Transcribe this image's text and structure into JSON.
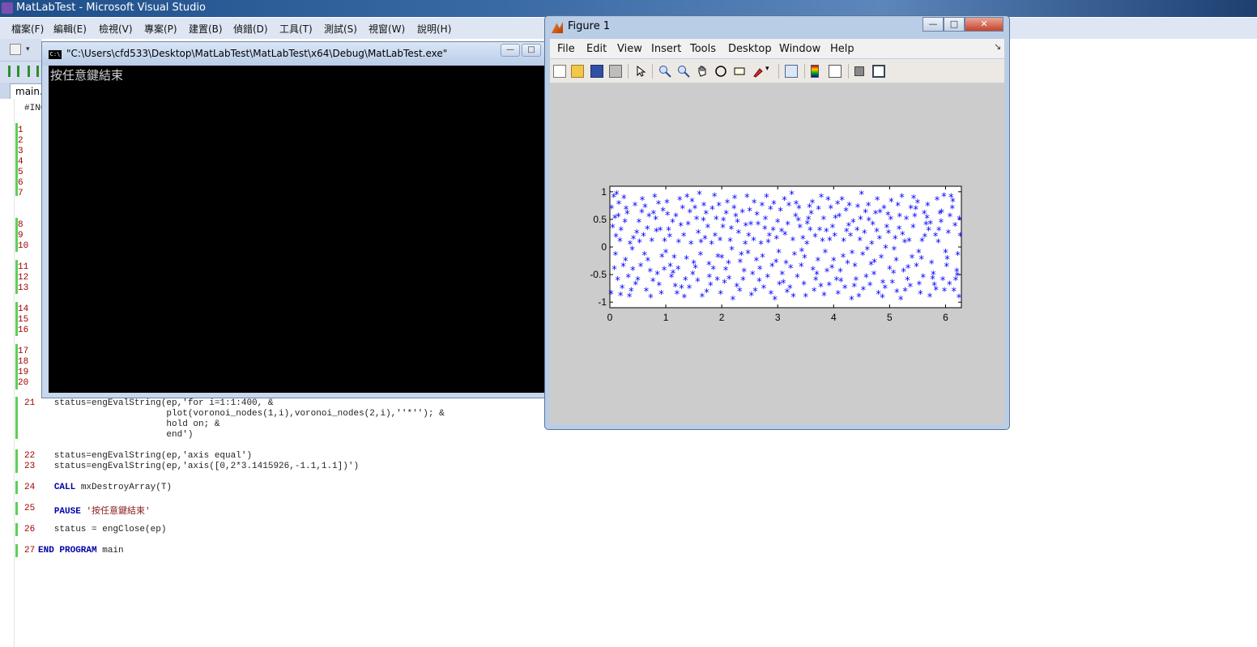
{
  "vs": {
    "window_title": "MatLabTest - Microsoft Visual Studio",
    "menu": [
      "檔案(F)",
      "編輯(E)",
      "檢視(V)",
      "專案(P)",
      "建置(B)",
      "偵錯(D)",
      "工具(T)",
      "測試(S)",
      "視窗(W)",
      "說明(H)"
    ],
    "tab_label": "main.",
    "first_line_fragment": "#INC"
  },
  "code": {
    "visible_line_numbers": [
      "1",
      "2",
      "3",
      "4",
      "5",
      "6",
      "7",
      "8",
      "9",
      "10",
      "11",
      "12",
      "13",
      "14",
      "15",
      "16",
      "17",
      "18",
      "19",
      "20"
    ],
    "lines": [
      {
        "num": "21",
        "text": "   status=engEvalString(ep,'for i=1:1:400, &"
      },
      {
        "num": "",
        "text": "                        plot(voronoi_nodes(1,i),voronoi_nodes(2,i),''*''); &"
      },
      {
        "num": "",
        "text": "                        hold on; &"
      },
      {
        "num": "",
        "text": "                        end')"
      },
      {
        "num": "22",
        "text": "   status=engEvalString(ep,'axis equal')"
      },
      {
        "num": "23",
        "text": "   status=engEvalString(ep,'axis([0,2*3.1415926,-1.1,1.1])')"
      },
      {
        "num": "24",
        "kw": "CALL",
        "text": " mxDestroyArray(T)"
      },
      {
        "num": "25",
        "kw": "PAUSE",
        "str": "'按任意鍵結束'"
      },
      {
        "num": "26",
        "text": "   status = engClose(ep)"
      },
      {
        "num": "27",
        "kw": "END PROGRAM",
        "text": " main"
      }
    ]
  },
  "console": {
    "title": "\"C:\\Users\\cfd533\\Desktop\\MatLabTest\\MatLabTest\\x64\\Debug\\MatLabTest.exe\"",
    "icon_label": "C:\\",
    "output": "按任意鍵結束",
    "min_btn": "—",
    "max_btn": "□"
  },
  "figure": {
    "title": "Figure 1",
    "menu": [
      "File",
      "Edit",
      "View",
      "Insert",
      "Tools",
      "Desktop",
      "Window",
      "Help"
    ],
    "menu_arrow": "↘",
    "min_btn": "—",
    "max_btn": "□",
    "close_btn": "✕"
  },
  "chart_data": {
    "type": "scatter",
    "marker": "*",
    "color": "#0000ff",
    "xlim": [
      0,
      6.2832
    ],
    "ylim": [
      -1.1,
      1.1
    ],
    "xticks": [
      "0",
      "1",
      "2",
      "3",
      "4",
      "5",
      "6"
    ],
    "yticks": [
      "1",
      "0.5",
      "0",
      "-0.5",
      "-1"
    ],
    "xtick_values": [
      0,
      1,
      2,
      3,
      4,
      5,
      6
    ],
    "ytick_values": [
      1,
      0.5,
      0,
      -0.5,
      -1
    ],
    "n_points": 400,
    "points": [
      [
        0.12,
        0.95
      ],
      [
        0.25,
        0.88
      ],
      [
        0.31,
        0.6
      ],
      [
        0.05,
        0.35
      ],
      [
        0.18,
        0.1
      ],
      [
        0.4,
        -0.05
      ],
      [
        0.08,
        -0.4
      ],
      [
        0.22,
        -0.75
      ],
      [
        0.35,
        -0.9
      ],
      [
        0.5,
        -0.6
      ],
      [
        0.6,
        0.2
      ],
      [
        0.7,
        0.55
      ],
      [
        0.8,
        0.9
      ],
      [
        0.9,
        0.3
      ],
      [
        1.0,
        -0.1
      ],
      [
        1.1,
        -0.55
      ],
      [
        1.2,
        -0.85
      ],
      [
        1.3,
        0.7
      ],
      [
        1.4,
        0.4
      ],
      [
        1.5,
        -0.3
      ],
      [
        1.6,
        0.95
      ],
      [
        1.7,
        0.15
      ],
      [
        1.8,
        -0.7
      ],
      [
        1.9,
        0.5
      ],
      [
        2.0,
        -0.2
      ],
      [
        2.1,
        0.8
      ],
      [
        2.2,
        -0.95
      ],
      [
        2.3,
        0.25
      ],
      [
        2.4,
        -0.45
      ],
      [
        2.5,
        0.65
      ],
      [
        2.6,
        -0.8
      ],
      [
        2.7,
        0.05
      ],
      [
        2.8,
        0.9
      ],
      [
        2.9,
        -0.35
      ],
      [
        3.0,
        0.45
      ],
      [
        3.1,
        -0.65
      ],
      [
        3.2,
        0.75
      ],
      [
        3.3,
        -0.15
      ],
      [
        3.4,
        0.35
      ],
      [
        3.5,
        -0.9
      ],
      [
        3.6,
        0.6
      ],
      [
        3.7,
        -0.5
      ],
      [
        3.8,
        0.1
      ],
      [
        3.9,
        0.85
      ],
      [
        4.0,
        -0.25
      ],
      [
        4.1,
        0.55
      ],
      [
        4.2,
        -0.75
      ],
      [
        4.3,
        0.2
      ],
      [
        4.4,
        -0.6
      ],
      [
        4.5,
        0.95
      ],
      [
        4.6,
        -0.05
      ],
      [
        4.7,
        0.4
      ],
      [
        4.8,
        -0.85
      ],
      [
        4.9,
        0.7
      ],
      [
        5.0,
        -0.4
      ],
      [
        5.1,
        0.15
      ],
      [
        5.2,
        -0.95
      ],
      [
        5.3,
        0.5
      ],
      [
        5.4,
        -0.2
      ],
      [
        5.5,
        0.8
      ],
      [
        5.6,
        -0.55
      ],
      [
        5.7,
        0.3
      ],
      [
        5.8,
        -0.7
      ],
      [
        5.9,
        0.6
      ],
      [
        6.0,
        -0.1
      ],
      [
        6.1,
        0.9
      ],
      [
        6.2,
        -0.45
      ],
      [
        0.15,
        0.55
      ],
      [
        0.28,
        -0.25
      ],
      [
        0.45,
        0.75
      ],
      [
        0.55,
        -0.35
      ],
      [
        0.65,
        -0.8
      ],
      [
        0.75,
        0.1
      ],
      [
        0.85,
        -0.5
      ],
      [
        0.95,
        0.65
      ],
      [
        1.05,
        0.3
      ],
      [
        1.15,
        -0.2
      ],
      [
        1.25,
        0.85
      ],
      [
        1.35,
        -0.6
      ],
      [
        1.45,
        0.05
      ],
      [
        1.55,
        0.5
      ],
      [
        1.65,
        -0.9
      ],
      [
        1.75,
        0.35
      ],
      [
        1.85,
        -0.4
      ],
      [
        1.95,
        0.75
      ],
      [
        2.05,
        -0.65
      ],
      [
        2.15,
        0.1
      ],
      [
        2.25,
        0.55
      ],
      [
        2.35,
        -0.15
      ],
      [
        2.45,
        0.9
      ],
      [
        2.55,
        -0.5
      ],
      [
        2.65,
        0.4
      ],
      [
        2.75,
        -0.75
      ],
      [
        2.85,
        0.2
      ],
      [
        2.95,
        -0.95
      ],
      [
        3.05,
        0.65
      ],
      [
        3.15,
        -0.3
      ],
      [
        3.25,
        0.95
      ],
      [
        3.35,
        -0.55
      ],
      [
        3.45,
        0.15
      ],
      [
        3.55,
        0.5
      ],
      [
        3.65,
        -0.8
      ],
      [
        3.75,
        0.3
      ],
      [
        3.85,
        -0.1
      ],
      [
        3.95,
        0.7
      ],
      [
        4.05,
        -0.6
      ],
      [
        4.15,
        0.85
      ],
      [
        4.25,
        -0.3
      ],
      [
        4.35,
        0.45
      ],
      [
        4.45,
        -0.9
      ],
      [
        4.55,
        0.25
      ],
      [
        4.65,
        -0.7
      ],
      [
        4.75,
        0.6
      ],
      [
        4.85,
        -0.2
      ],
      [
        4.95,
        0.35
      ],
      [
        5.05,
        -0.65
      ],
      [
        5.15,
        0.75
      ],
      [
        5.25,
        -0.45
      ],
      [
        5.35,
        0.1
      ],
      [
        5.45,
        0.55
      ],
      [
        5.55,
        -0.85
      ],
      [
        5.65,
        0.4
      ],
      [
        5.75,
        -0.3
      ],
      [
        5.85,
        0.85
      ],
      [
        5.95,
        -0.6
      ],
      [
        6.05,
        0.25
      ],
      [
        6.15,
        -0.8
      ],
      [
        6.25,
        0.5
      ],
      [
        0.03,
        0.7
      ],
      [
        0.1,
        -0.15
      ],
      [
        0.2,
        0.3
      ],
      [
        0.33,
        -0.55
      ],
      [
        0.42,
        0.15
      ],
      [
        0.52,
        0.45
      ],
      [
        0.62,
        -0.15
      ],
      [
        0.72,
        -0.45
      ],
      [
        0.82,
        0.5
      ],
      [
        0.92,
        -0.85
      ],
      [
        1.02,
        0.8
      ],
      [
        1.12,
        0.45
      ],
      [
        1.22,
        -0.4
      ],
      [
        1.32,
        0.2
      ],
      [
        1.42,
        -0.75
      ],
      [
        1.52,
        0.7
      ],
      [
        1.62,
        -0.15
      ],
      [
        1.72,
        0.6
      ],
      [
        1.82,
        0.05
      ],
      [
        1.92,
        -0.6
      ],
      [
        2.02,
        0.35
      ],
      [
        2.12,
        -0.3
      ],
      [
        2.22,
        0.7
      ],
      [
        2.32,
        -0.8
      ],
      [
        2.42,
        0.05
      ],
      [
        2.52,
        0.4
      ],
      [
        2.62,
        -0.25
      ],
      [
        2.72,
        0.75
      ],
      [
        2.82,
        -0.55
      ],
      [
        2.92,
        0.3
      ],
      [
        3.02,
        -0.1
      ],
      [
        3.12,
        0.85
      ],
      [
        3.22,
        -0.75
      ],
      [
        3.32,
        0.55
      ],
      [
        3.42,
        -0.35
      ],
      [
        3.52,
        0.05
      ],
      [
        3.62,
        0.8
      ],
      [
        3.72,
        -0.25
      ],
      [
        3.82,
        0.5
      ],
      [
        3.92,
        -0.7
      ],
      [
        4.02,
        0.2
      ],
      [
        4.12,
        -0.45
      ],
      [
        4.22,
        0.65
      ],
      [
        4.32,
        -0.95
      ],
      [
        4.42,
        0.3
      ],
      [
        4.52,
        -0.15
      ],
      [
        4.62,
        0.75
      ],
      [
        4.72,
        -0.5
      ],
      [
        4.82,
        0.15
      ],
      [
        4.92,
        -0.75
      ],
      [
        5.02,
        0.5
      ],
      [
        5.12,
        -0.25
      ],
      [
        5.22,
        0.9
      ],
      [
        5.32,
        -0.6
      ],
      [
        5.42,
        0.35
      ],
      [
        5.52,
        -0.1
      ],
      [
        5.62,
        0.6
      ],
      [
        5.72,
        -0.9
      ],
      [
        5.82,
        0.2
      ],
      [
        5.92,
        0.45
      ],
      [
        6.02,
        -0.35
      ],
      [
        6.12,
        0.7
      ],
      [
        6.22,
        -0.15
      ],
      [
        0.07,
        0.9
      ],
      [
        0.14,
        -0.6
      ],
      [
        0.27,
        0.45
      ],
      [
        0.38,
        -0.8
      ],
      [
        0.48,
        0.25
      ],
      [
        0.58,
        0.85
      ],
      [
        0.68,
        -0.25
      ],
      [
        0.78,
        0.6
      ],
      [
        0.88,
        -0.7
      ],
      [
        0.98,
        0.1
      ],
      [
        1.08,
        -0.35
      ],
      [
        1.18,
        0.55
      ],
      [
        1.28,
        -0.75
      ],
      [
        1.38,
        0.9
      ],
      [
        1.48,
        -0.5
      ],
      [
        1.58,
        0.25
      ],
      [
        1.68,
        0.75
      ],
      [
        1.78,
        -0.55
      ],
      [
        1.88,
        0.2
      ],
      [
        1.98,
        -0.85
      ],
      [
        2.08,
        0.6
      ],
      [
        2.18,
        -0.05
      ],
      [
        2.28,
        0.45
      ],
      [
        2.38,
        -0.6
      ],
      [
        2.48,
        0.2
      ],
      [
        2.58,
        0.8
      ],
      [
        2.68,
        -0.4
      ],
      [
        2.78,
        0.5
      ],
      [
        2.88,
        -0.85
      ],
      [
        2.98,
        0.15
      ],
      [
        3.08,
        -0.5
      ],
      [
        3.18,
        0.4
      ],
      [
        3.28,
        -0.9
      ],
      [
        3.38,
        0.7
      ],
      [
        3.48,
        -0.2
      ],
      [
        3.58,
        0.3
      ],
      [
        3.68,
        -0.6
      ],
      [
        3.78,
        0.9
      ],
      [
        3.88,
        -0.45
      ],
      [
        3.98,
        0.35
      ],
      [
        4.08,
        -0.85
      ],
      [
        4.18,
        0.1
      ],
      [
        4.28,
        0.75
      ],
      [
        4.38,
        -0.35
      ],
      [
        4.48,
        0.5
      ],
      [
        4.58,
        -0.55
      ],
      [
        4.68,
        0.05
      ],
      [
        4.78,
        0.85
      ],
      [
        4.88,
        -0.65
      ],
      [
        4.98,
        0.25
      ],
      [
        5.08,
        -0.05
      ],
      [
        5.18,
        0.55
      ],
      [
        5.28,
        -0.8
      ],
      [
        5.38,
        0.7
      ],
      [
        5.48,
        -0.35
      ],
      [
        5.58,
        0.1
      ],
      [
        5.68,
        0.75
      ],
      [
        5.78,
        -0.5
      ],
      [
        5.88,
        0.3
      ],
      [
        5.98,
        -0.8
      ],
      [
        6.08,
        0.55
      ],
      [
        6.18,
        -0.6
      ],
      [
        6.26,
        0.2
      ],
      [
        0.02,
        -0.85
      ],
      [
        0.16,
        0.78
      ],
      [
        0.24,
        -0.35
      ],
      [
        0.36,
        0.05
      ],
      [
        0.46,
        -0.68
      ],
      [
        0.57,
        0.62
      ],
      [
        0.67,
        0.32
      ],
      [
        0.77,
        -0.62
      ],
      [
        0.87,
        0.78
      ],
      [
        0.97,
        -0.42
      ],
      [
        1.07,
        0.18
      ],
      [
        1.17,
        -0.72
      ],
      [
        1.27,
        0.38
      ],
      [
        1.37,
        -0.22
      ],
      [
        1.47,
        0.82
      ],
      [
        1.57,
        -0.62
      ],
      [
        1.67,
        0.48
      ],
      [
        1.77,
        -0.32
      ],
      [
        1.87,
        0.92
      ],
      [
        1.97,
        0.12
      ],
      [
        2.07,
        -0.42
      ],
      [
        2.17,
        0.32
      ],
      [
        2.27,
        -0.72
      ],
      [
        2.37,
        0.62
      ],
      [
        2.47,
        -0.12
      ],
      [
        2.57,
        0.12
      ],
      [
        2.67,
        -0.62
      ],
      [
        2.77,
        0.32
      ],
      [
        2.87,
        0.68
      ],
      [
        2.97,
        -0.28
      ],
      [
        3.07,
        0.28
      ],
      [
        3.17,
        -0.82
      ],
      [
        3.27,
        0.12
      ],
      [
        3.37,
        0.48
      ],
      [
        3.47,
        -0.68
      ],
      [
        3.57,
        0.72
      ],
      [
        3.67,
        0.18
      ],
      [
        3.77,
        -0.72
      ],
      [
        3.87,
        0.28
      ],
      [
        3.97,
        -0.38
      ],
      [
        4.07,
        0.78
      ],
      [
        4.17,
        -0.18
      ],
      [
        4.27,
        0.38
      ],
      [
        4.37,
        -0.72
      ],
      [
        4.47,
        0.12
      ],
      [
        4.57,
        0.62
      ],
      [
        4.67,
        -0.32
      ],
      [
        4.77,
        0.28
      ],
      [
        4.87,
        -0.92
      ],
      [
        4.97,
        0.58
      ],
      [
        5.07,
        -0.48
      ],
      [
        5.17,
        0.32
      ],
      [
        5.27,
        0.08
      ],
      [
        5.37,
        -0.72
      ],
      [
        5.47,
        0.68
      ],
      [
        5.57,
        -0.22
      ],
      [
        5.67,
        0.52
      ],
      [
        5.77,
        -0.58
      ],
      [
        5.87,
        0.08
      ],
      [
        5.97,
        0.92
      ],
      [
        6.07,
        -0.68
      ],
      [
        6.17,
        0.38
      ],
      [
        6.24,
        -0.92
      ],
      [
        0.11,
        0.18
      ],
      [
        0.29,
        0.68
      ],
      [
        0.41,
        -0.42
      ],
      [
        0.53,
        0.08
      ],
      [
        0.63,
        0.72
      ],
      [
        0.73,
        -0.92
      ],
      [
        0.83,
        0.28
      ],
      [
        0.93,
        -0.18
      ],
      [
        1.03,
        0.58
      ],
      [
        1.13,
        -0.48
      ],
      [
        1.23,
        0.08
      ],
      [
        1.33,
        -0.92
      ],
      [
        1.43,
        0.62
      ],
      [
        1.53,
        -0.38
      ],
      [
        1.63,
        0.08
      ],
      [
        1.73,
        -0.82
      ],
      [
        1.83,
        0.68
      ],
      [
        1.93,
        -0.18
      ],
      [
        2.03,
        0.48
      ],
      [
        2.13,
        -0.58
      ],
      [
        2.23,
        0.88
      ],
      [
        2.33,
        -0.28
      ],
      [
        2.43,
        0.38
      ],
      [
        2.53,
        -0.88
      ],
      [
        2.63,
        0.58
      ],
      [
        2.73,
        -0.18
      ],
      [
        2.83,
        0.08
      ],
      [
        2.93,
        0.78
      ],
      [
        3.03,
        -0.68
      ],
      [
        3.13,
        0.22
      ],
      [
        3.23,
        -0.38
      ],
      [
        3.33,
        0.78
      ],
      [
        3.43,
        -0.08
      ],
      [
        3.53,
        0.42
      ],
      [
        3.63,
        -0.42
      ],
      [
        3.73,
        0.68
      ],
      [
        3.83,
        -0.88
      ],
      [
        3.93,
        0.12
      ],
      [
        4.03,
        0.52
      ],
      [
        4.13,
        -0.62
      ],
      [
        4.23,
        0.28
      ],
      [
        4.33,
        -0.12
      ],
      [
        4.43,
        0.72
      ],
      [
        4.53,
        -0.78
      ],
      [
        4.63,
        0.48
      ],
      [
        4.73,
        -0.28
      ],
      [
        4.83,
        0.62
      ],
      [
        4.93,
        -0.02
      ],
      [
        5.03,
        0.82
      ],
      [
        5.13,
        -0.82
      ],
      [
        5.23,
        0.22
      ],
      [
        5.33,
        -0.38
      ],
      [
        5.43,
        0.88
      ],
      [
        5.53,
        -0.68
      ],
      [
        5.63,
        0.18
      ],
      [
        5.73,
        0.42
      ],
      [
        5.83,
        -0.78
      ],
      [
        5.93,
        0.62
      ],
      [
        6.03,
        -0.22
      ],
      [
        6.13,
        0.82
      ],
      [
        6.21,
        -0.52
      ],
      [
        0.09,
        0.52
      ],
      [
        0.19,
        -0.88
      ]
    ]
  }
}
